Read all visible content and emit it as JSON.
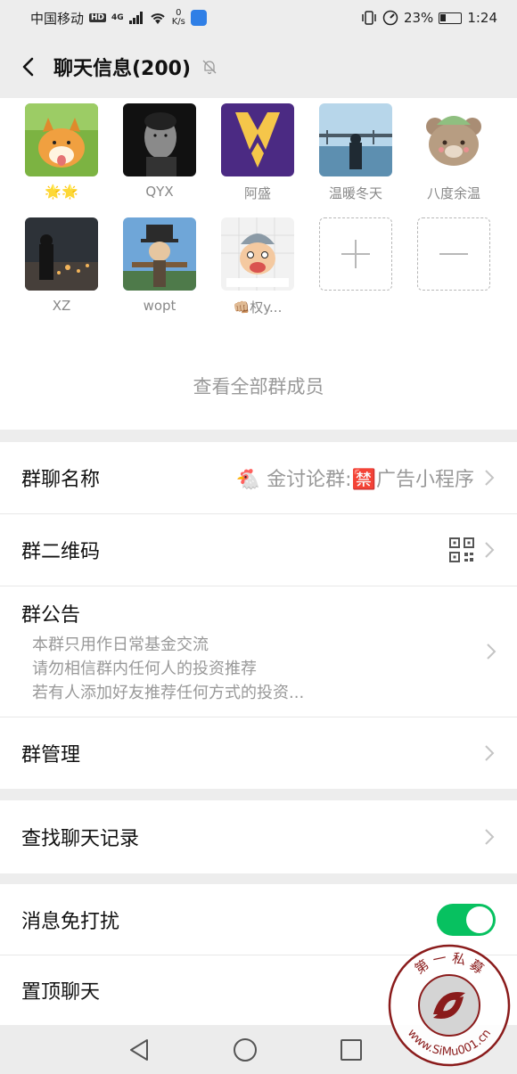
{
  "status_bar": {
    "carrier": "中国移动",
    "hd_badge": "HD",
    "network": "4G",
    "speed_value": "0",
    "speed_unit": "K/s",
    "battery_percent": "23%",
    "time": "1:24"
  },
  "header": {
    "title": "聊天信息(200)",
    "mute_icon": "bell-off-icon"
  },
  "members": [
    {
      "name": "🌟🌟"
    },
    {
      "name": "QYX"
    },
    {
      "name": "阿盛"
    },
    {
      "name": "温暖冬天"
    },
    {
      "name": "八度余温"
    },
    {
      "name": "XZ"
    },
    {
      "name": "wopt"
    },
    {
      "name": "👊🏼权y..."
    }
  ],
  "see_all_label": "查看全部群成员",
  "settings": {
    "group_name": {
      "label": "群聊名称",
      "value": "🐔 金讨论群:🈲广告小程序"
    },
    "qr_code": {
      "label": "群二维码",
      "icon": "qr-code-icon"
    },
    "announcement": {
      "label": "群公告",
      "lines": [
        "本群只用作日常基金交流",
        "请勿相信群内任何人的投资推荐",
        "若有人添加好友推荐任何方式的投资..."
      ]
    },
    "manage": {
      "label": "群管理"
    },
    "search_history": {
      "label": "查找聊天记录"
    },
    "mute": {
      "label": "消息免打扰",
      "enabled": true
    },
    "pin": {
      "label": "置顶聊天"
    }
  },
  "watermark": {
    "top_text": "第 一 私 募",
    "bottom_text": "www.SiMu001.cn"
  },
  "colors": {
    "accent_green": "#07c160",
    "background": "#ededed"
  }
}
